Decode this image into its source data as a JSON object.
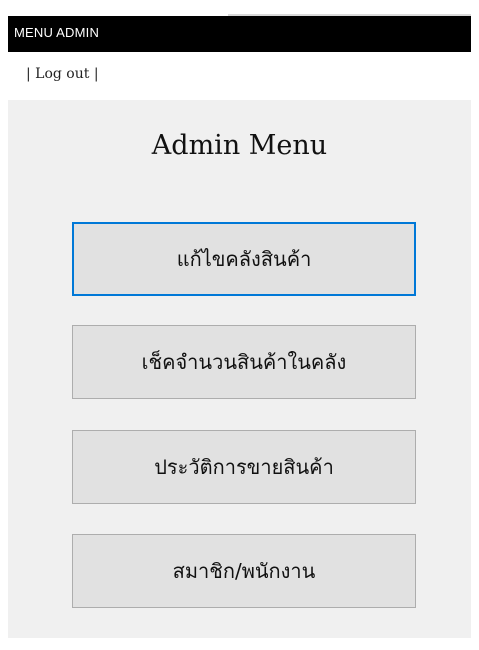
{
  "window": {
    "title": "MENU ADMIN"
  },
  "menubar": {
    "logout_label": "| Log out |"
  },
  "main": {
    "heading": "Admin Menu",
    "buttons": [
      {
        "label": "แก้ไขคลังสินค้า",
        "focused": true
      },
      {
        "label": "เช็คจำนวนสินค้าในคลัง",
        "focused": false
      },
      {
        "label": "ประวัติการขายสินค้า",
        "focused": false
      },
      {
        "label": "สมาชิก/พนักงาน",
        "focused": false
      }
    ]
  },
  "colors": {
    "titlebar": "#000000",
    "content_background": "#f0f0f0",
    "button_background": "#e1e1e1",
    "button_border": "#adadad",
    "focus_border": "#0078d7"
  }
}
